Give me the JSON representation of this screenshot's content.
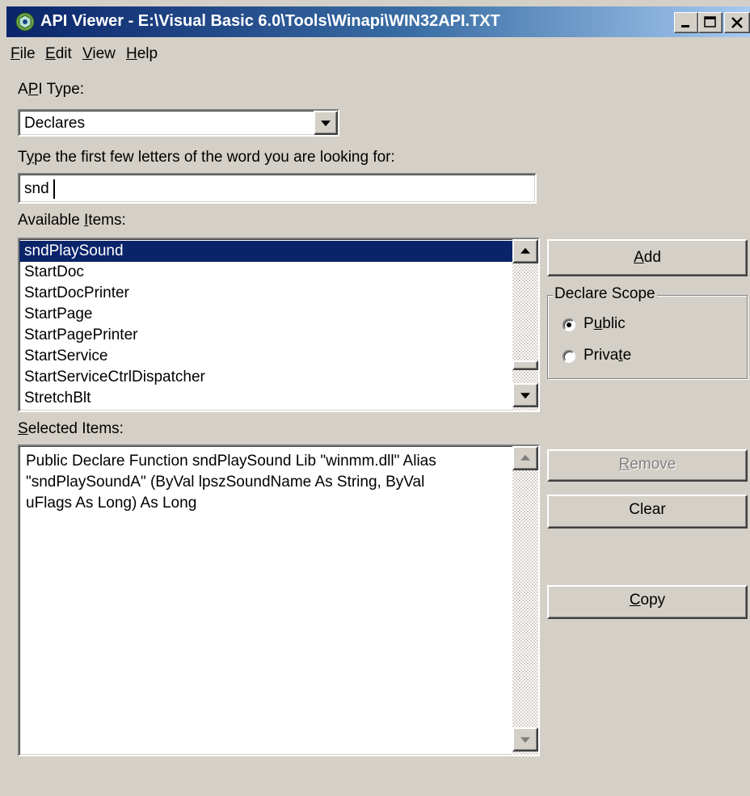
{
  "window": {
    "title": "API Viewer - E:\\Visual Basic 6.0\\Tools\\Winapi\\WIN32API.TXT",
    "controls": {
      "minimize": "_",
      "maximize": "□",
      "close": "×"
    }
  },
  "menu": {
    "file": {
      "accel": "F",
      "rest": "ile"
    },
    "edit": {
      "accel": "E",
      "rest": "dit"
    },
    "view": {
      "accel": "V",
      "rest": "iew"
    },
    "help": {
      "accel": "H",
      "rest": "elp"
    }
  },
  "api_type": {
    "label_pre": "A",
    "label_accel": "P",
    "label_post": "I Type:",
    "selected": "Declares"
  },
  "search": {
    "label_pre": "T",
    "label_accel": "y",
    "label_post": "pe the first few letters of the word you are looking for:",
    "value": "snd"
  },
  "available": {
    "label_pre": "Available ",
    "label_accel": "I",
    "label_post": "tems:",
    "items": [
      "sndPlaySound",
      "StartDoc",
      "StartDocPrinter",
      "StartPage",
      "StartPagePrinter",
      "StartService",
      "StartServiceCtrlDispatcher",
      "StretchBlt"
    ],
    "selected_index": 0
  },
  "buttons": {
    "add": {
      "accel": "A",
      "rest": "dd"
    },
    "remove": {
      "accel": "R",
      "rest": "emove"
    },
    "clear": "Clear",
    "copy": {
      "accel": "C",
      "rest": "opy"
    }
  },
  "scope": {
    "legend": "Declare Scope",
    "public": {
      "pre": "P",
      "accel": "u",
      "post": "blic",
      "checked": true
    },
    "private": {
      "pre": "Priva",
      "accel": "t",
      "post": "e",
      "checked": false
    }
  },
  "selected": {
    "label_pre": "",
    "label_accel": "S",
    "label_post": "elected Items:",
    "text": "Public Declare Function sndPlaySound Lib \"winmm.dll\" Alias\n\"sndPlaySoundA\" (ByVal lpszSoundName As String, ByVal\nuFlags As Long) As Long"
  },
  "colors": {
    "face": "#d4d0c8",
    "selection": "#0a246a",
    "title_start": "#0a246a",
    "title_end": "#a6caf0"
  }
}
